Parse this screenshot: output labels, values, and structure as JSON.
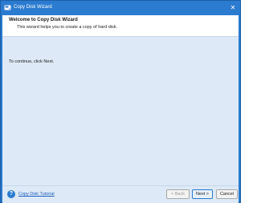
{
  "window": {
    "title": "Copy Disk Wizard",
    "close_glyph": "✕"
  },
  "header": {
    "title": "Welcome to Copy Disk Wizard",
    "subtitle": "This wizard helps you to create a copy of hard disk."
  },
  "content": {
    "instruction": "To continue, click Next."
  },
  "footer": {
    "help_icon_glyph": "?",
    "help_link": "Copy Disk Tutorial",
    "back_label": "< Back",
    "next_label": "Next >",
    "cancel_label": "Cancel"
  },
  "colors": {
    "accent": "#2b7bd0",
    "content_bg": "#dde9f6"
  }
}
